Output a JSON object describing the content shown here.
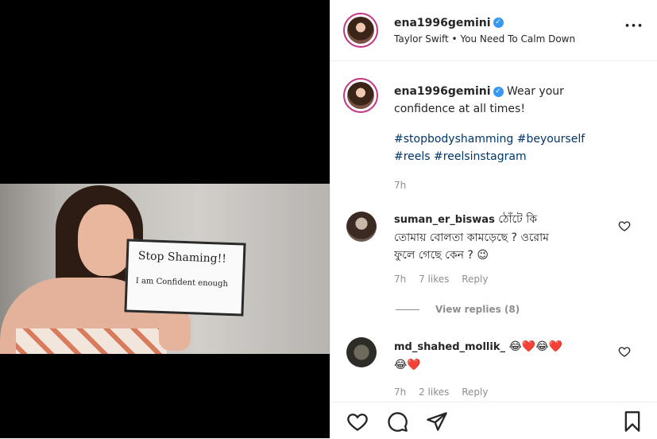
{
  "post": {
    "username": "ena1996gemini",
    "audio": "Taylor Swift • You Need To Calm Down",
    "more": "•••"
  },
  "photo_sign": {
    "line1": "Stop Shaming!!",
    "line2": "I am Confident enough"
  },
  "caption": {
    "username": "ena1996gemini",
    "text1": "Wear your",
    "text2": "confidence at all times!",
    "tags_line1": "#stopbodyshamming #beyourself",
    "tags_line2": "#reels #reelsinstagram",
    "time": "7h"
  },
  "comments": [
    {
      "username": "suman_er_biswas",
      "line1": "ঠোঁটে কি",
      "line2": "তোমায় বোলতা কামড়েছে ? ওরোম",
      "line3": "ফুলে গেছে কেন ? 😉",
      "time": "7h",
      "likes": "7 likes",
      "reply": "Reply",
      "view_replies": "View replies (8)"
    },
    {
      "username": "md_shahed_mollik_",
      "line1": "😂❤️😂❤️",
      "line2": "😂❤️",
      "time": "7h",
      "likes": "2 likes",
      "reply": "Reply"
    }
  ],
  "icons": [
    "heart-icon",
    "comment-icon",
    "share-icon",
    "bookmark-icon",
    "more-icon",
    "verified-icon"
  ],
  "colors": {
    "accent": "#3897f0",
    "link": "#00376b",
    "muted": "#8e8e8e",
    "ring": "#c13584"
  }
}
